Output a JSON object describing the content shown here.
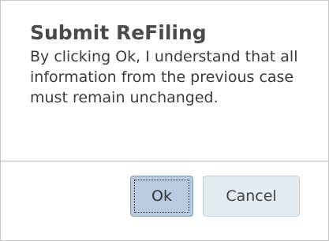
{
  "dialog": {
    "title": "Submit ReFiling",
    "message": "By clicking Ok, I understand that all information from the previous case must remain unchanged.",
    "ok_label": "Ok",
    "cancel_label": "Cancel"
  }
}
